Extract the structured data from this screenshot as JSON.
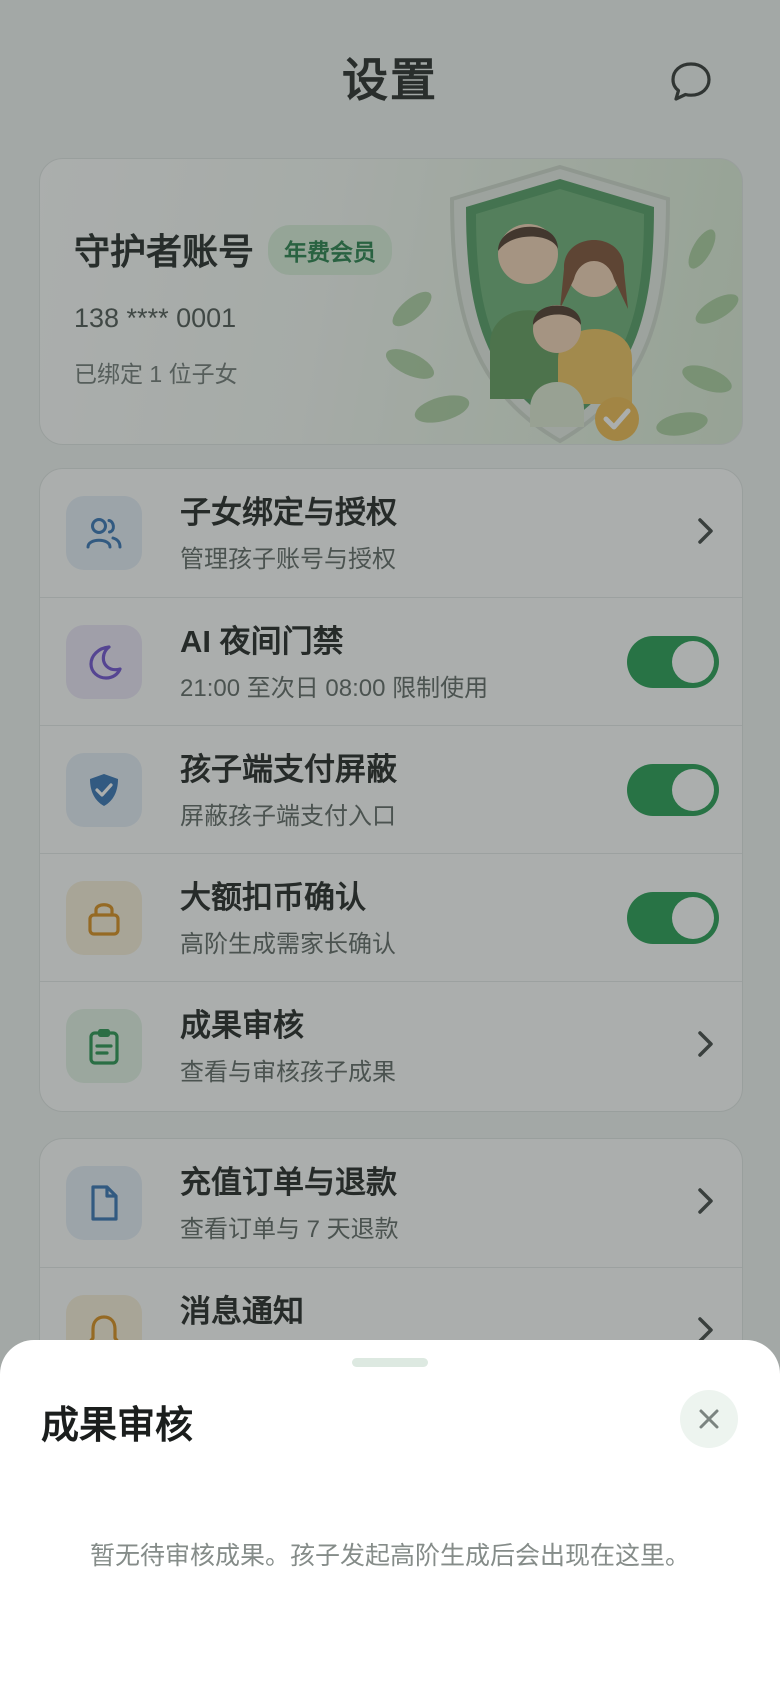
{
  "header": {
    "title": "设置"
  },
  "profile": {
    "name": "守护者账号",
    "badge": "年费会员",
    "phone": "138 **** 0001",
    "kids": "已绑定 1 位子女"
  },
  "settings_main": [
    {
      "title": "子女绑定与授权",
      "subtitle": "管理孩子账号与授权",
      "icon": "people-icon",
      "control": "chevron"
    },
    {
      "title": "AI 夜间门禁",
      "subtitle": "21:00 至次日 08:00 限制使用",
      "icon": "moon-icon",
      "control": "toggle",
      "on": true
    },
    {
      "title": "孩子端支付屏蔽",
      "subtitle": "屏蔽孩子端支付入口",
      "icon": "shield-check-icon",
      "control": "toggle",
      "on": true
    },
    {
      "title": "大额扣币确认",
      "subtitle": "高阶生成需家长确认",
      "icon": "lock-icon",
      "control": "toggle",
      "on": true
    },
    {
      "title": "成果审核",
      "subtitle": "查看与审核孩子成果",
      "icon": "clipboard-icon",
      "control": "chevron"
    }
  ],
  "settings_secondary": [
    {
      "title": "充值订单与退款",
      "subtitle": "查看订单与 7 天退款",
      "icon": "document-icon",
      "control": "chevron"
    },
    {
      "title": "消息通知",
      "subtitle": "",
      "icon": "bell-icon",
      "control": "chevron"
    }
  ],
  "sheet": {
    "title": "成果审核",
    "empty_text": "暂无待审核成果。孩子发起高阶生成后会出现在这里。"
  },
  "colors": {
    "accent_green": "#1e9a4d",
    "badge_bg": "#d9efd9",
    "overlay": "rgba(55,62,60,0.42)"
  }
}
